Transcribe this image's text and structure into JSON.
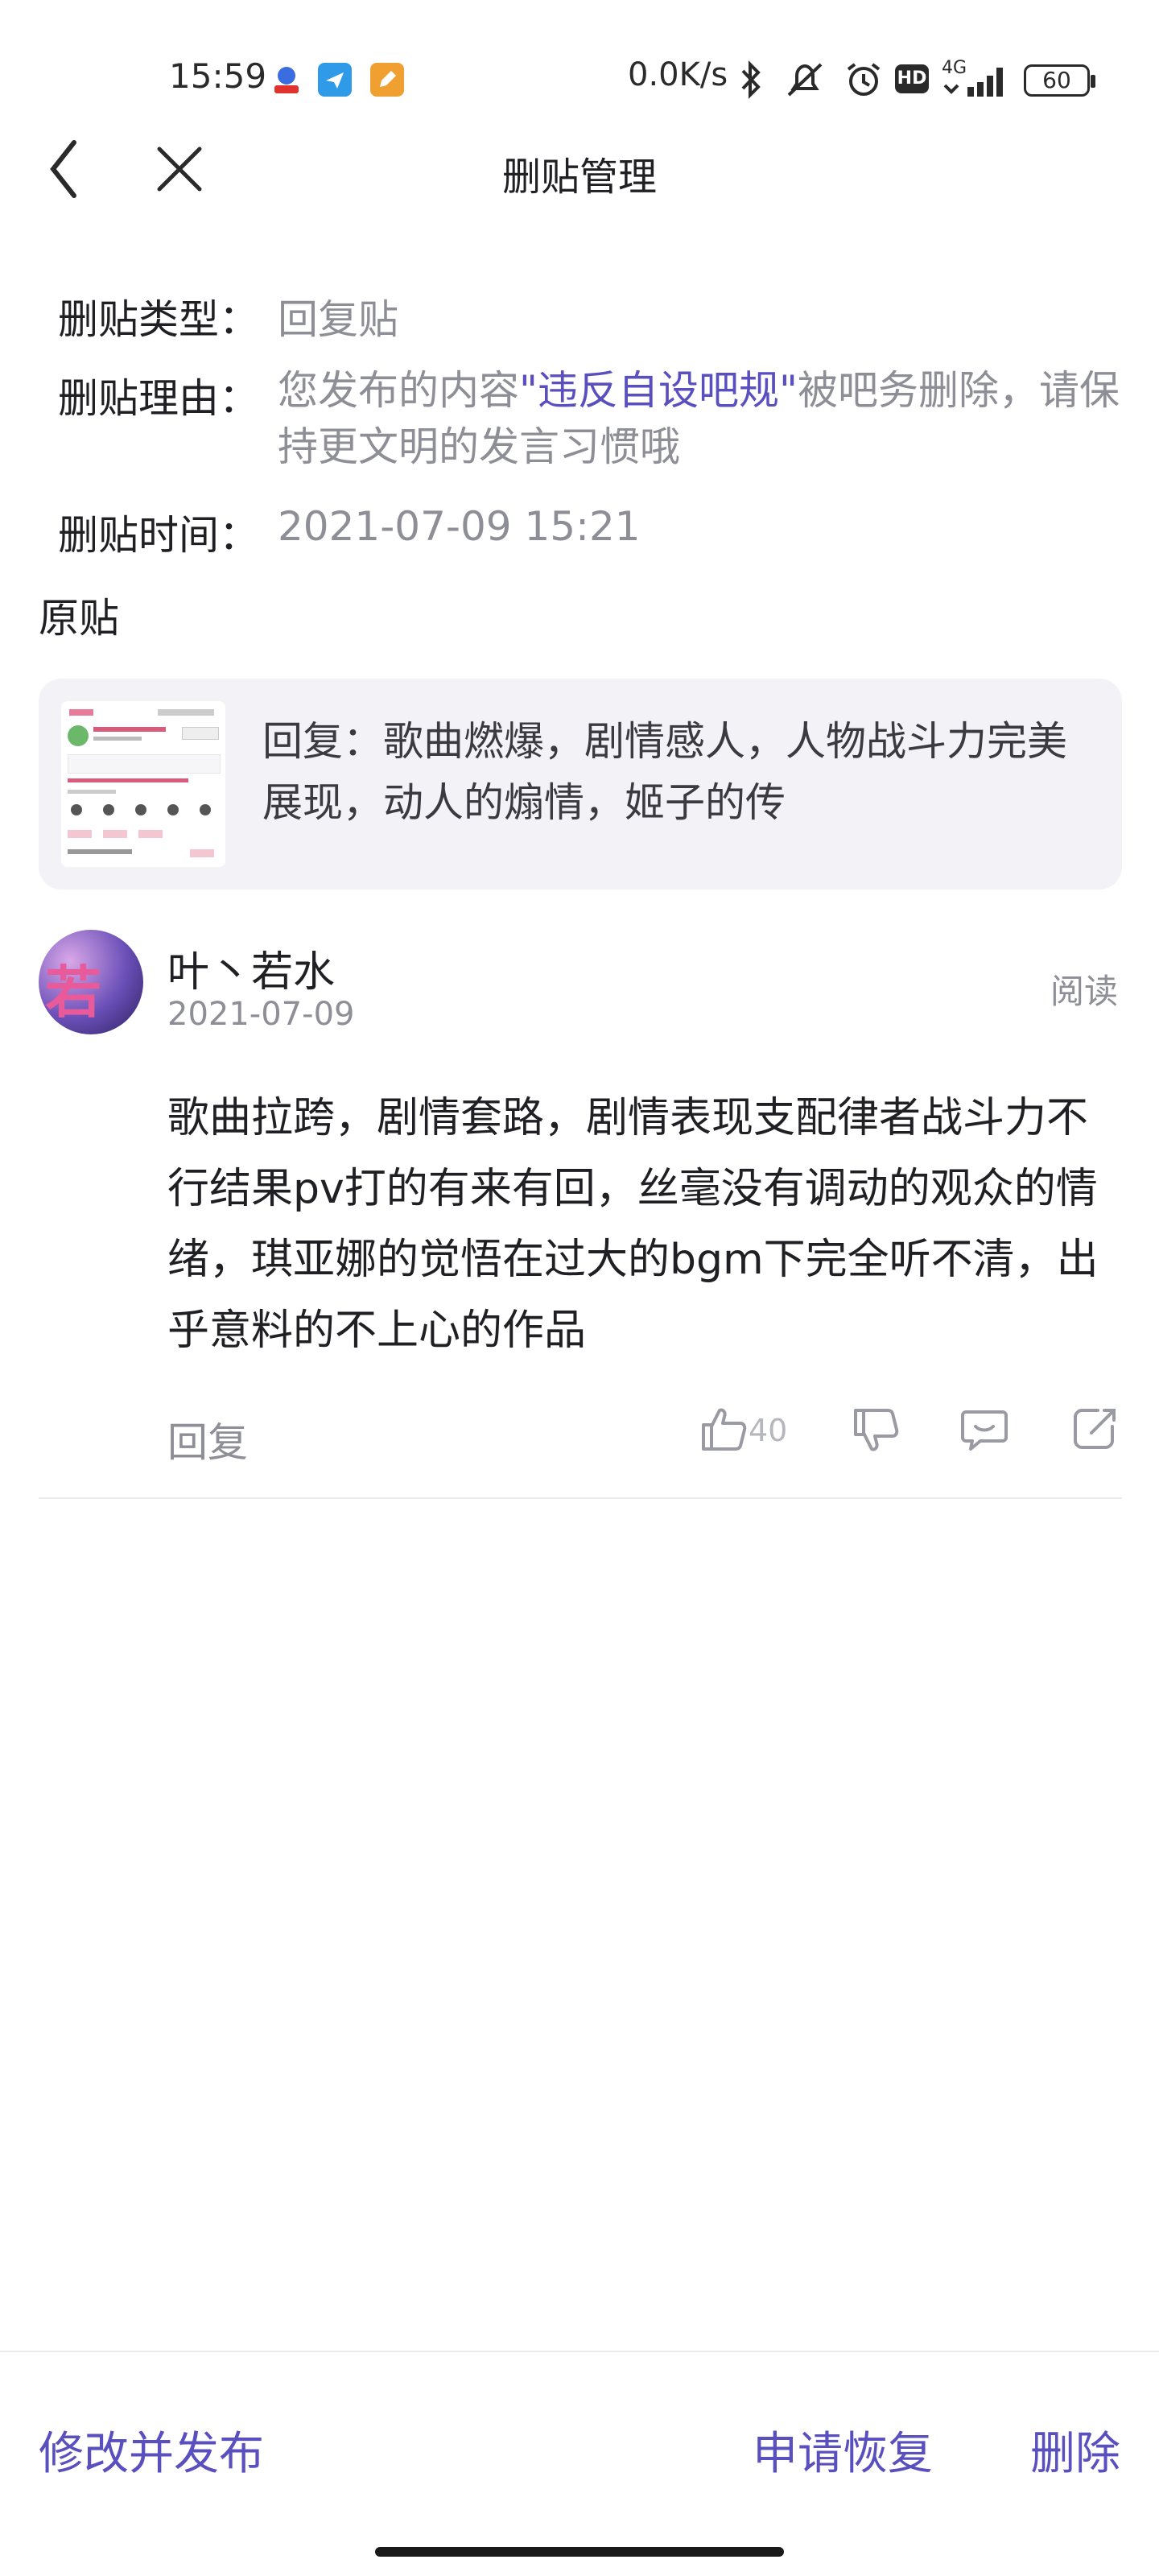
{
  "status_bar": {
    "time": "15:59",
    "network_speed": "0.0K/s",
    "network_type": "4G",
    "hd_label": "HD",
    "battery": "60",
    "icons": [
      "baidu-app-icon",
      "send-app-icon",
      "edit-app-icon",
      "bluetooth-icon",
      "mute-icon",
      "alarm-icon",
      "hd-icon",
      "signal-icon",
      "battery-icon"
    ]
  },
  "nav": {
    "title": "删贴管理",
    "back_icon": "chevron-left-icon",
    "close_icon": "close-icon"
  },
  "info": {
    "type_label": "删贴类型：",
    "type_value": "回复贴",
    "reason_label": "删贴理由：",
    "reason_prefix": "您发布的内容",
    "reason_highlight": "\"违反自设吧规\"",
    "reason_suffix": "被吧务删除，请保持更文明的发言习惯哦",
    "time_label": "删贴时间：",
    "time_value": "2021-07-09 15:21"
  },
  "original": {
    "section_label": "原贴",
    "card_text": "回复：歌曲燃爆，剧情感人，人物战斗力完美展现，动人的煽情，姬子的传"
  },
  "comment": {
    "username": "叶丶若水",
    "avatar_text": "若水",
    "date": "2021-07-09",
    "read_label": "阅读",
    "body": "歌曲拉跨，剧情套路，剧情表现支配律者战斗力不行结果pv打的有来有回，丝毫没有调动的观众的情绪，琪亚娜的觉悟在过大的bgm下完全听不清，出乎意料的不上心的作品",
    "reply_label": "回复",
    "like_count": "40"
  },
  "bottom_bar": {
    "edit_publish": "修改并发布",
    "request_restore": "申请恢复",
    "delete": "删除"
  },
  "colors": {
    "accent": "#5a4fbf",
    "muted_text": "#8e8e96",
    "card_bg": "#f3f3f7"
  }
}
